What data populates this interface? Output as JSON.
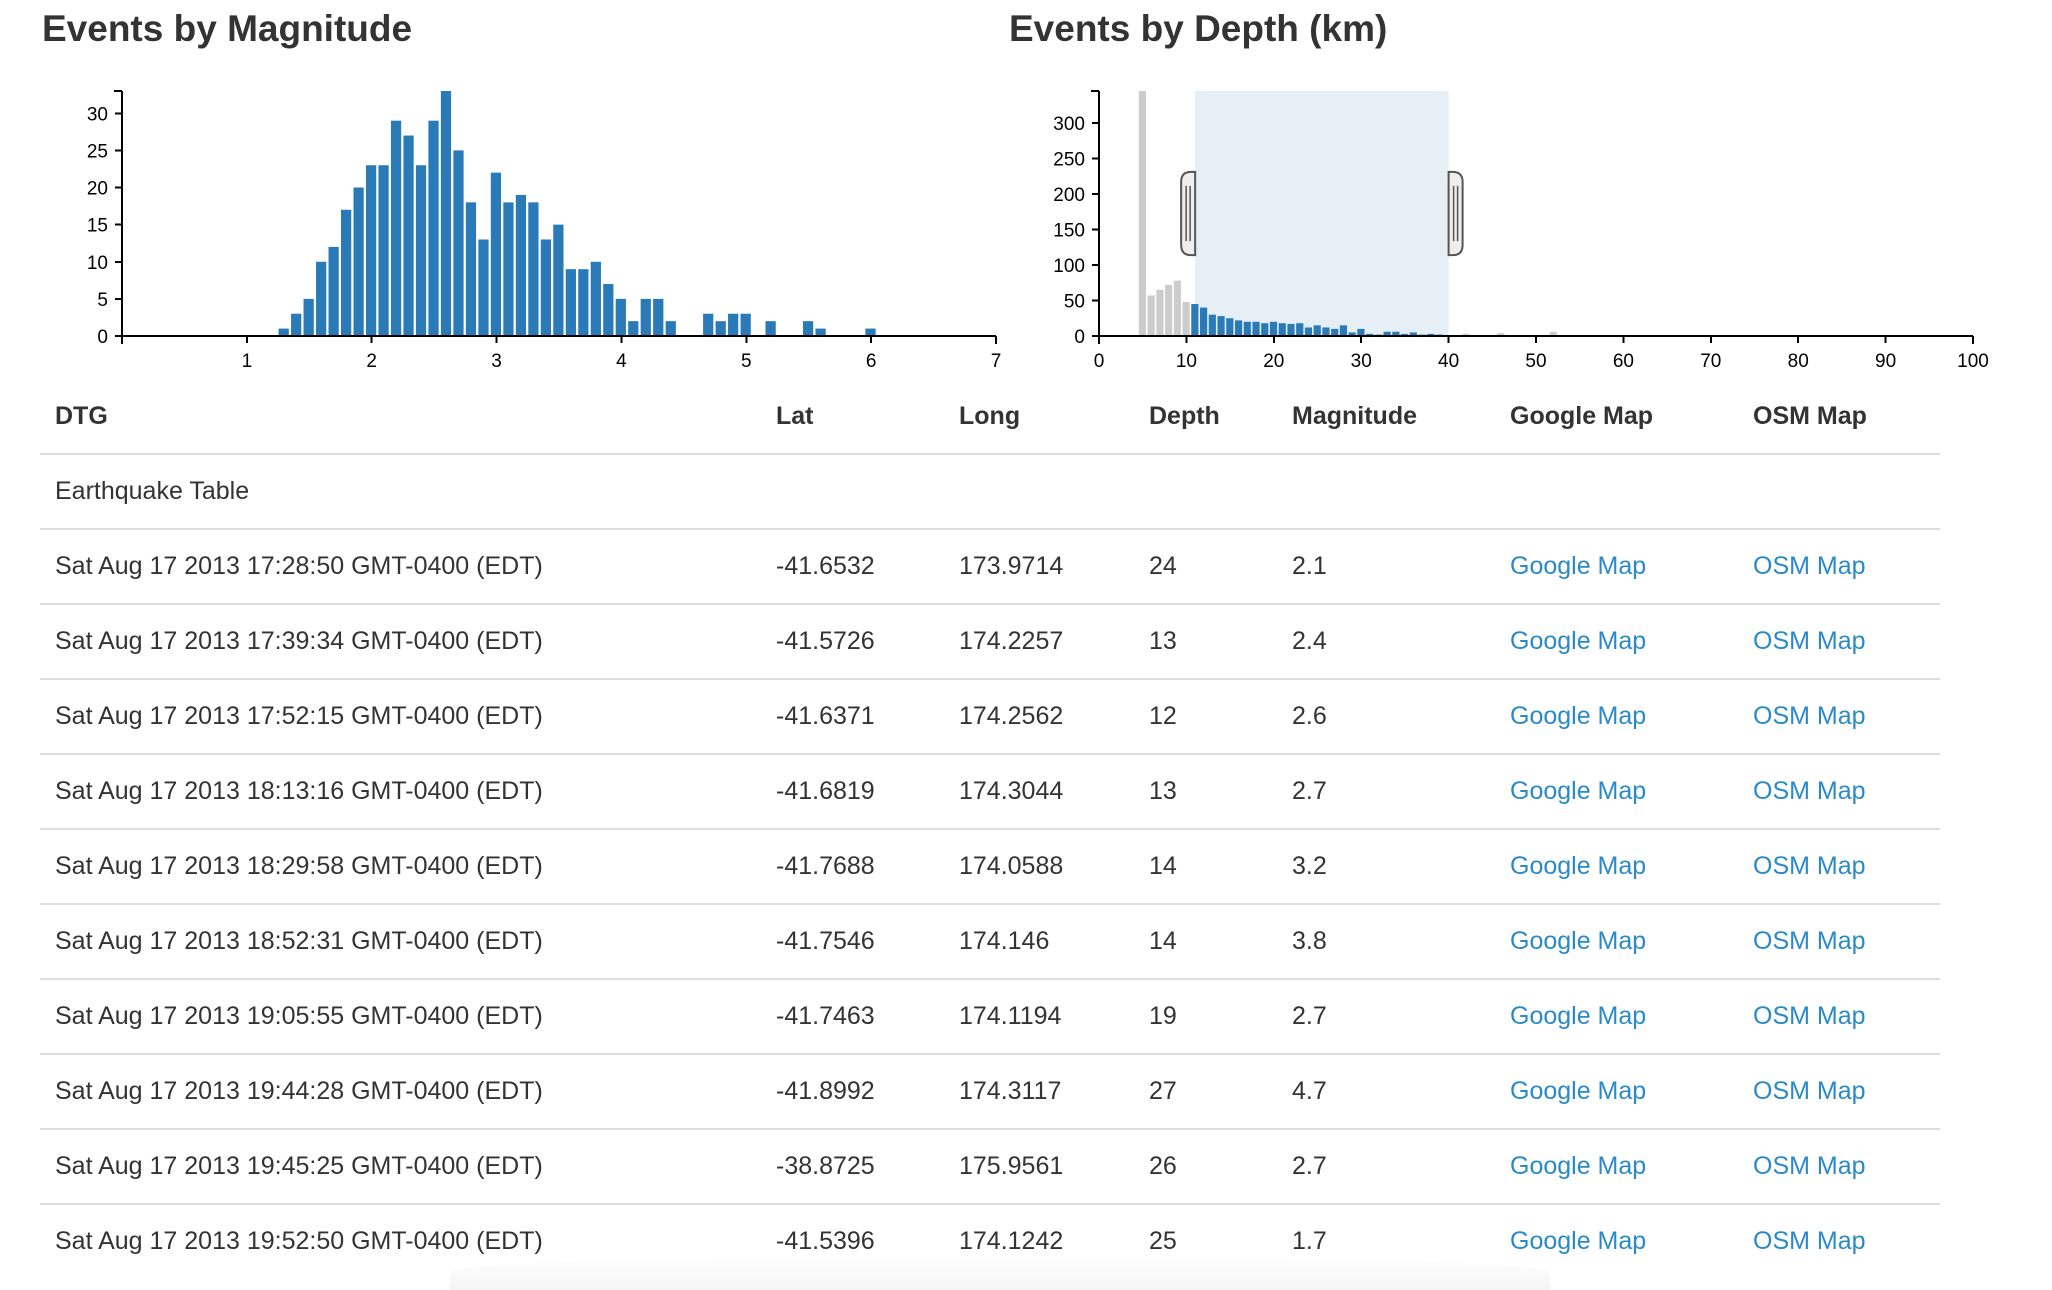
{
  "colors": {
    "bar": "#2a7ab8",
    "bar_inactive": "#cccccc",
    "brush": "#e6eef6",
    "link": "#2a8ac8",
    "text": "#333333",
    "border": "#dddddd"
  },
  "chart_data": [
    {
      "type": "bar",
      "title": "Events by Magnitude",
      "xlabel": "",
      "ylabel": "",
      "xlim": [
        0,
        7
      ],
      "ylim": [
        0,
        33
      ],
      "bin_width": 0.1,
      "x_ticks": [
        1,
        2,
        3,
        4,
        5,
        6,
        7
      ],
      "y_ticks": [
        0,
        5,
        10,
        15,
        20,
        25,
        30
      ],
      "x": [
        1.3,
        1.4,
        1.5,
        1.6,
        1.7,
        1.8,
        1.9,
        2.0,
        2.1,
        2.2,
        2.3,
        2.4,
        2.5,
        2.6,
        2.7,
        2.8,
        2.9,
        3.0,
        3.1,
        3.2,
        3.3,
        3.4,
        3.5,
        3.6,
        3.7,
        3.8,
        3.9,
        4.0,
        4.1,
        4.2,
        4.3,
        4.4,
        4.7,
        4.8,
        4.9,
        5.0,
        5.2,
        5.5,
        5.6,
        6.0
      ],
      "values": [
        1,
        3,
        5,
        10,
        12,
        17,
        20,
        23,
        23,
        29,
        27,
        23,
        29,
        33,
        25,
        18,
        13,
        22,
        18,
        19,
        18,
        13,
        15,
        9,
        9,
        10,
        7,
        5,
        2,
        5,
        5,
        2,
        3,
        2,
        3,
        3,
        2,
        2,
        1,
        1
      ]
    },
    {
      "type": "bar",
      "title": "Events by Depth (km)",
      "xlabel": "",
      "ylabel": "",
      "xlim": [
        0,
        100
      ],
      "ylim": [
        0,
        345
      ],
      "bin_width": 1,
      "x_ticks": [
        0,
        10,
        20,
        30,
        40,
        50,
        60,
        70,
        80,
        90,
        100
      ],
      "y_ticks": [
        0,
        50,
        100,
        150,
        200,
        250,
        300
      ],
      "brush_extent": [
        11,
        40
      ],
      "x": [
        5,
        6,
        7,
        8,
        9,
        10,
        11,
        12,
        13,
        14,
        15,
        16,
        17,
        18,
        19,
        20,
        21,
        22,
        23,
        24,
        25,
        26,
        27,
        28,
        29,
        30,
        31,
        32,
        33,
        34,
        35,
        36,
        37,
        38,
        39,
        42,
        46,
        52
      ],
      "values": [
        345,
        57,
        65,
        72,
        78,
        48,
        45,
        40,
        30,
        28,
        25,
        22,
        20,
        20,
        18,
        20,
        18,
        17,
        18,
        12,
        15,
        12,
        10,
        15,
        5,
        10,
        3,
        2,
        6,
        6,
        3,
        5,
        2,
        3,
        2,
        3,
        4,
        6
      ]
    }
  ],
  "table": {
    "headers": [
      "DTG",
      "Lat",
      "Long",
      "Depth",
      "Magnitude",
      "Google Map",
      "OSM Map"
    ],
    "group_label": "Earthquake Table",
    "rows": [
      {
        "dtg": "Sat Aug 17 2013 17:28:50 GMT-0400 (EDT)",
        "lat": "-41.6532",
        "long": "173.9714",
        "depth": "24",
        "mag": "2.1",
        "google": "Google Map",
        "osm": "OSM Map"
      },
      {
        "dtg": "Sat Aug 17 2013 17:39:34 GMT-0400 (EDT)",
        "lat": "-41.5726",
        "long": "174.2257",
        "depth": "13",
        "mag": "2.4",
        "google": "Google Map",
        "osm": "OSM Map"
      },
      {
        "dtg": "Sat Aug 17 2013 17:52:15 GMT-0400 (EDT)",
        "lat": "-41.6371",
        "long": "174.2562",
        "depth": "12",
        "mag": "2.6",
        "google": "Google Map",
        "osm": "OSM Map"
      },
      {
        "dtg": "Sat Aug 17 2013 18:13:16 GMT-0400 (EDT)",
        "lat": "-41.6819",
        "long": "174.3044",
        "depth": "13",
        "mag": "2.7",
        "google": "Google Map",
        "osm": "OSM Map"
      },
      {
        "dtg": "Sat Aug 17 2013 18:29:58 GMT-0400 (EDT)",
        "lat": "-41.7688",
        "long": "174.0588",
        "depth": "14",
        "mag": "3.2",
        "google": "Google Map",
        "osm": "OSM Map"
      },
      {
        "dtg": "Sat Aug 17 2013 18:52:31 GMT-0400 (EDT)",
        "lat": "-41.7546",
        "long": "174.146",
        "depth": "14",
        "mag": "3.8",
        "google": "Google Map",
        "osm": "OSM Map"
      },
      {
        "dtg": "Sat Aug 17 2013 19:05:55 GMT-0400 (EDT)",
        "lat": "-41.7463",
        "long": "174.1194",
        "depth": "19",
        "mag": "2.7",
        "google": "Google Map",
        "osm": "OSM Map"
      },
      {
        "dtg": "Sat Aug 17 2013 19:44:28 GMT-0400 (EDT)",
        "lat": "-41.8992",
        "long": "174.3117",
        "depth": "27",
        "mag": "4.7",
        "google": "Google Map",
        "osm": "OSM Map"
      },
      {
        "dtg": "Sat Aug 17 2013 19:45:25 GMT-0400 (EDT)",
        "lat": "-38.8725",
        "long": "175.9561",
        "depth": "26",
        "mag": "2.7",
        "google": "Google Map",
        "osm": "OSM Map"
      },
      {
        "dtg": "Sat Aug 17 2013 19:52:50 GMT-0400 (EDT)",
        "lat": "-41.5396",
        "long": "174.1242",
        "depth": "25",
        "mag": "1.7",
        "google": "Google Map",
        "osm": "OSM Map"
      }
    ]
  }
}
